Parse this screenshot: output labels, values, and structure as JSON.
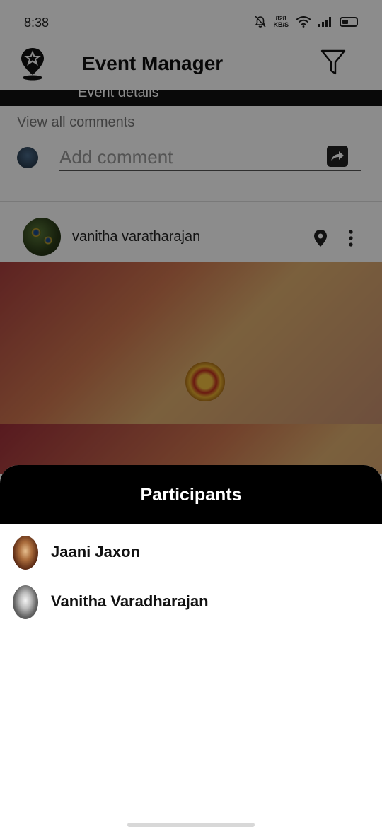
{
  "status_bar": {
    "time": "8:38",
    "speed_value": "828",
    "speed_unit": "KB/S"
  },
  "app_bar": {
    "title": "Event Manager",
    "logo_icon": "map-pin-star-icon",
    "filter_icon": "filter-funnel-icon"
  },
  "tabs": {
    "partial_label": "Event details"
  },
  "comments": {
    "view_all_label": "View all comments",
    "input_placeholder": "Add comment",
    "send_icon": "share-arrow-icon"
  },
  "post": {
    "author": "vanitha varatharajan",
    "location_icon": "location-pin-icon",
    "more_icon": "more-vertical-icon"
  },
  "participants_sheet": {
    "title": "Participants",
    "items": [
      {
        "name": "Jaani Jaxon"
      },
      {
        "name": "Vanitha Varadharajan"
      }
    ]
  },
  "colors": {
    "sheet_header_bg": "#000000",
    "overlay": "rgba(0,0,0,0.45)",
    "text_primary": "#111111"
  }
}
